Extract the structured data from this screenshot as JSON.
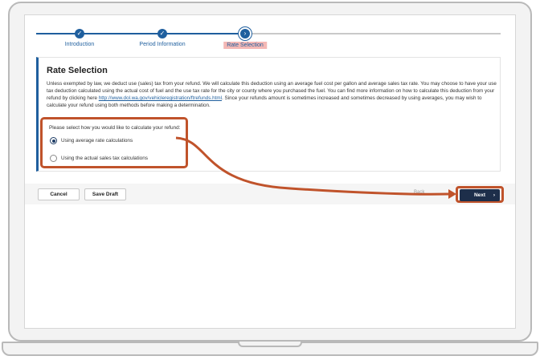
{
  "stepper": {
    "steps": [
      {
        "label": "Introduction",
        "state": "complete"
      },
      {
        "label": "Period Information",
        "state": "complete"
      },
      {
        "label": "Rate Selection",
        "state": "current"
      }
    ]
  },
  "card": {
    "title": "Rate Selection",
    "description_1": "Unless exempted by law, we deduct use (sales) tax from your refund. We will calculate this deduction using an average fuel cost per gallon and average sales tax rate. You may choose to have your use tax deduction calculated using the actual cost of fuel and the use tax rate for the city or county where you purchased the fuel. You can find more information on how to calculate this deduction from your refund by clicking here ",
    "link_text": "http://www.dol.wa.gov/vehicleregistration/ftrefunds.html",
    "description_2": ". Since your refunds amount is sometimes increased and sometimes decreased by using averages, you may wish to calculate your refund using both methods before making a determination.",
    "question": "Please select how you would like to calculate your refund:",
    "options": [
      {
        "label": "Using average rate calculations",
        "selected": true
      },
      {
        "label": "Using the actual sales tax calculations",
        "selected": false
      }
    ]
  },
  "footer": {
    "cancel_label": "Cancel",
    "save_draft_label": "Save Draft",
    "back_label": "Back",
    "next_label": "Next",
    "next_icon": "chevron-right-icon"
  },
  "colors": {
    "accent": "#1f5f9e",
    "next_button": "#1d2e4a",
    "annotation": "#c0532b",
    "current_step_highlight": "#f4b8b5"
  }
}
